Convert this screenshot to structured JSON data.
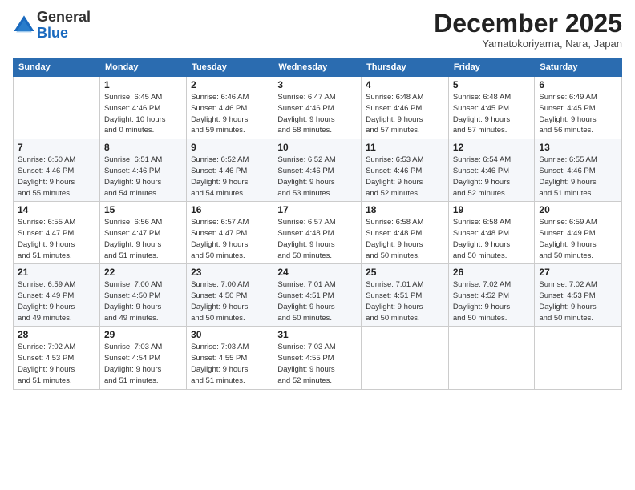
{
  "logo": {
    "general": "General",
    "blue": "Blue"
  },
  "title": "December 2025",
  "subtitle": "Yamatokoriyama, Nara, Japan",
  "days_of_week": [
    "Sunday",
    "Monday",
    "Tuesday",
    "Wednesday",
    "Thursday",
    "Friday",
    "Saturday"
  ],
  "weeks": [
    [
      {
        "day": "",
        "info": ""
      },
      {
        "day": "1",
        "info": "Sunrise: 6:45 AM\nSunset: 4:46 PM\nDaylight: 10 hours\nand 0 minutes."
      },
      {
        "day": "2",
        "info": "Sunrise: 6:46 AM\nSunset: 4:46 PM\nDaylight: 9 hours\nand 59 minutes."
      },
      {
        "day": "3",
        "info": "Sunrise: 6:47 AM\nSunset: 4:46 PM\nDaylight: 9 hours\nand 58 minutes."
      },
      {
        "day": "4",
        "info": "Sunrise: 6:48 AM\nSunset: 4:46 PM\nDaylight: 9 hours\nand 57 minutes."
      },
      {
        "day": "5",
        "info": "Sunrise: 6:48 AM\nSunset: 4:45 PM\nDaylight: 9 hours\nand 57 minutes."
      },
      {
        "day": "6",
        "info": "Sunrise: 6:49 AM\nSunset: 4:45 PM\nDaylight: 9 hours\nand 56 minutes."
      }
    ],
    [
      {
        "day": "7",
        "info": "Sunrise: 6:50 AM\nSunset: 4:46 PM\nDaylight: 9 hours\nand 55 minutes."
      },
      {
        "day": "8",
        "info": "Sunrise: 6:51 AM\nSunset: 4:46 PM\nDaylight: 9 hours\nand 54 minutes."
      },
      {
        "day": "9",
        "info": "Sunrise: 6:52 AM\nSunset: 4:46 PM\nDaylight: 9 hours\nand 54 minutes."
      },
      {
        "day": "10",
        "info": "Sunrise: 6:52 AM\nSunset: 4:46 PM\nDaylight: 9 hours\nand 53 minutes."
      },
      {
        "day": "11",
        "info": "Sunrise: 6:53 AM\nSunset: 4:46 PM\nDaylight: 9 hours\nand 52 minutes."
      },
      {
        "day": "12",
        "info": "Sunrise: 6:54 AM\nSunset: 4:46 PM\nDaylight: 9 hours\nand 52 minutes."
      },
      {
        "day": "13",
        "info": "Sunrise: 6:55 AM\nSunset: 4:46 PM\nDaylight: 9 hours\nand 51 minutes."
      }
    ],
    [
      {
        "day": "14",
        "info": "Sunrise: 6:55 AM\nSunset: 4:47 PM\nDaylight: 9 hours\nand 51 minutes."
      },
      {
        "day": "15",
        "info": "Sunrise: 6:56 AM\nSunset: 4:47 PM\nDaylight: 9 hours\nand 51 minutes."
      },
      {
        "day": "16",
        "info": "Sunrise: 6:57 AM\nSunset: 4:47 PM\nDaylight: 9 hours\nand 50 minutes."
      },
      {
        "day": "17",
        "info": "Sunrise: 6:57 AM\nSunset: 4:48 PM\nDaylight: 9 hours\nand 50 minutes."
      },
      {
        "day": "18",
        "info": "Sunrise: 6:58 AM\nSunset: 4:48 PM\nDaylight: 9 hours\nand 50 minutes."
      },
      {
        "day": "19",
        "info": "Sunrise: 6:58 AM\nSunset: 4:48 PM\nDaylight: 9 hours\nand 50 minutes."
      },
      {
        "day": "20",
        "info": "Sunrise: 6:59 AM\nSunset: 4:49 PM\nDaylight: 9 hours\nand 50 minutes."
      }
    ],
    [
      {
        "day": "21",
        "info": "Sunrise: 6:59 AM\nSunset: 4:49 PM\nDaylight: 9 hours\nand 49 minutes."
      },
      {
        "day": "22",
        "info": "Sunrise: 7:00 AM\nSunset: 4:50 PM\nDaylight: 9 hours\nand 49 minutes."
      },
      {
        "day": "23",
        "info": "Sunrise: 7:00 AM\nSunset: 4:50 PM\nDaylight: 9 hours\nand 50 minutes."
      },
      {
        "day": "24",
        "info": "Sunrise: 7:01 AM\nSunset: 4:51 PM\nDaylight: 9 hours\nand 50 minutes."
      },
      {
        "day": "25",
        "info": "Sunrise: 7:01 AM\nSunset: 4:51 PM\nDaylight: 9 hours\nand 50 minutes."
      },
      {
        "day": "26",
        "info": "Sunrise: 7:02 AM\nSunset: 4:52 PM\nDaylight: 9 hours\nand 50 minutes."
      },
      {
        "day": "27",
        "info": "Sunrise: 7:02 AM\nSunset: 4:53 PM\nDaylight: 9 hours\nand 50 minutes."
      }
    ],
    [
      {
        "day": "28",
        "info": "Sunrise: 7:02 AM\nSunset: 4:53 PM\nDaylight: 9 hours\nand 51 minutes."
      },
      {
        "day": "29",
        "info": "Sunrise: 7:03 AM\nSunset: 4:54 PM\nDaylight: 9 hours\nand 51 minutes."
      },
      {
        "day": "30",
        "info": "Sunrise: 7:03 AM\nSunset: 4:55 PM\nDaylight: 9 hours\nand 51 minutes."
      },
      {
        "day": "31",
        "info": "Sunrise: 7:03 AM\nSunset: 4:55 PM\nDaylight: 9 hours\nand 52 minutes."
      },
      {
        "day": "",
        "info": ""
      },
      {
        "day": "",
        "info": ""
      },
      {
        "day": "",
        "info": ""
      }
    ]
  ]
}
